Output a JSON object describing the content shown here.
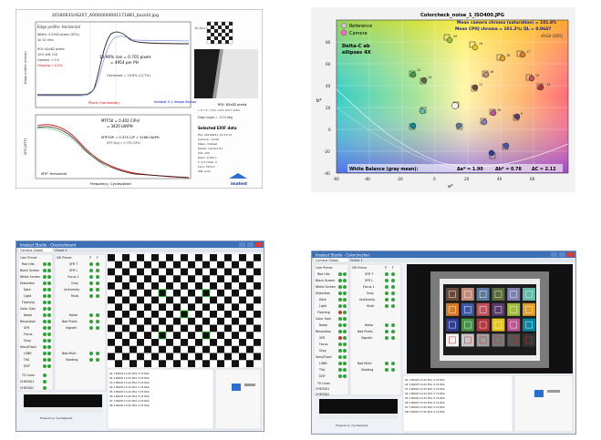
{
  "edge": {
    "file_title": "20180631HS207_A0000004001171881_backlit.jpg",
    "date": "10-Jun-2018 10:15:12",
    "profile_title": "Edge profile: Horizontal",
    "info": [
      "Width: 4.5000 pixels (50%)",
      "3x 10 4ms",
      "ROI: 62x82 pixels",
      "10% left: 0.6",
      "Gamma = 0.5",
      "Clipping = 0.0%"
    ],
    "rise_main": "10-90% rise = 0.701 pixels",
    "rise_sub": "= 4954 per PH",
    "overshoot": "Overshoot = 20.8% (12.7%)",
    "ylabel": "Edge profile (linear)",
    "xlabel": "Pixels (horizontal)",
    "footer_label": "Imatest 5.1 Image Sensor",
    "roi": "ROI: 62x82 pixels",
    "roi_sub": "L R T B: 1792 1922 2007 2069",
    "mtf50": "MTF50 = 0.402 C/Pxl",
    "mtf50_lw": "= 3420 LW/PH",
    "mtf50p": "MTF50P = 0.373 C/P = 3166 LW/PH",
    "mtf_values": "MTF Nyq = 0.750 C/Pxl",
    "edge_angle": "Edge angle = -5.14 deg",
    "selected_exif": "Selected EXIF data",
    "exif_lines": [
      "File: 20180631_10:15:12",
      "Camera: model",
      "Make: Imatest",
      "Model: camera 01",
      "ISO: 100",
      "Expo: 1/100 s",
      "F: 4.0 Flash: 0",
      "Lens: 50mm",
      "WB: auto"
    ],
    "mtf_ylabel": "SFR (MTF)",
    "mtf_xlabel": "Frequency, Cycles/pixel",
    "mtf_title": "MTF: Horizontal",
    "brand": "imatest"
  },
  "color": {
    "title": "Colorcheck_noise_1_ISO400.JPG",
    "legend_reference": "Reference",
    "legend_camera": "Camera",
    "mean_chroma": "Mean camera chroma (saturation) = 101.8%",
    "mean_ciq": "Mean CPIQ chroma = 101.2%; QL = 0.0647",
    "colorspace": "sRGB (D65)",
    "delta_label": "Delta-C ab",
    "ellipses_label": "ellipses 4X",
    "wb_text": "White Balance (gray mean):",
    "delta_a": "Δa* = 1.90",
    "delta_b": "Δb* = 0.78",
    "delta_c": "ΔC = 2.12",
    "xlabel": "a*",
    "ylabel": "b*",
    "xticks": [
      "-60",
      "-40",
      "-20",
      "0",
      "20",
      "40",
      "60"
    ],
    "yticks": [
      "80",
      "60",
      "40",
      "20",
      "0",
      "-20",
      "-40"
    ],
    "patch_labels": [
      "19",
      "20",
      "18",
      "17",
      "16",
      "15",
      "14",
      "13",
      "12",
      "11",
      "10",
      "9",
      "8",
      "7",
      "6",
      "5",
      "4",
      "3",
      "2",
      "1",
      "21",
      "22",
      "23",
      "24"
    ]
  },
  "checker_app": {
    "title": "Imatest Studio - Checkerboard",
    "tabs": [
      "Camera Global",
      "Check 1"
    ],
    "left_header": "Cam Primer",
    "left_items": [
      "Red Hits",
      "Black Screen",
      "White Screen",
      "Distortion",
      "Dark",
      "Light",
      "Flashing",
      "Color Gain",
      "Noise",
      "Resolution",
      "SFR",
      "Focus",
      "Gray",
      "Sens/Flash",
      "LSNR",
      "TVA",
      "DOF"
    ],
    "right_header": "SW Primer",
    "right_items": [
      "SFR T",
      "SFR L",
      "Focus 1",
      "Gray",
      "Uniformity",
      "Mulb",
      "Noise",
      "Bad Pixels",
      "Vignett",
      "Bad Multi",
      "Shading"
    ],
    "bottom_items": [
      "TV Lines",
      "CHESS01",
      "CHESS02"
    ],
    "status": "Frequency, Cycles/pixel",
    "log_lines": [
      "01 1 BGSH 13.22 POL 3.72 PAS",
      "02 1 BGSH 13.22 POL 3.72 PAS",
      "03 1 BGSH 13.22 POL 3.72 PAS",
      "04 1 BGSH 13.22 POL 3.72 PAS",
      "05 1 BGSH 13.22 POL 3.72 PAS",
      "06 1 BGSH 13.22 POL 3.72 PAS",
      "07 1 BGSH 13.22 POL 3.72 PAS",
      "08 1 BGSH 13.22 POL 3.72 PAS"
    ],
    "pf": [
      "P",
      "F"
    ]
  },
  "color_app": {
    "title": "Imatest Studio - Colorchecker",
    "tabs": [
      "Camera Global",
      "Check 1"
    ],
    "left_header": "Cam Primer",
    "left_items": [
      "Red Hits",
      "Black Screen",
      "White Screen",
      "Distortion",
      "Dark",
      "Light",
      "Flashing",
      "Color Gain",
      "Noise",
      "Resolution",
      "SFR",
      "Focus",
      "Gray",
      "Sens/Flash",
      "LSNR",
      "TVA",
      "DOF"
    ],
    "right_header": "SW Primer",
    "right_items": [
      "SFR T",
      "SFR L",
      "Focus 1",
      "Gray",
      "Uniformity",
      "Mulb",
      "Noise",
      "Bad Pixels",
      "Vignett",
      "Bad Multi",
      "Shading"
    ],
    "bottom_items": [
      "TV Lines",
      "CHESS01",
      "CHESS02"
    ],
    "status": "Frequency, Cycles/pixel",
    "log_lines": [
      "01 1 BGSH 13.22 POL 3.72 PAS",
      "02 1 BGSH 13.22 POL 3.72 PAS",
      "03 1 BGSH 13.22 POL 3.72 PAS",
      "04 1 BGSH 13.22 POL 3.72 PAS",
      "05 1 BGSH 13.22 POL 3.72 PAS",
      "06 1 BGSH 13.22 POL 3.72 PAS",
      "07 1 BGSH 13.22 POL 3.72 PAS",
      "08 1 BGSH 13.22 POL 3.72 PAS"
    ],
    "pf": [
      "P",
      "F"
    ],
    "checker_colors": [
      "#6b4a3a",
      "#c18c7a",
      "#5b7a9d",
      "#5b6b3b",
      "#7f7fb1",
      "#62bba8",
      "#d67c2a",
      "#3f58a4",
      "#c1535f",
      "#5a3c6a",
      "#a0bb3e",
      "#e09e2b",
      "#2e3d92",
      "#479447",
      "#af363c",
      "#e7c71f",
      "#bb5695",
      "#0885a1",
      "#f3f3f2",
      "#c8c8c8",
      "#a0a0a0",
      "#7a7a79",
      "#555555",
      "#343434"
    ]
  }
}
